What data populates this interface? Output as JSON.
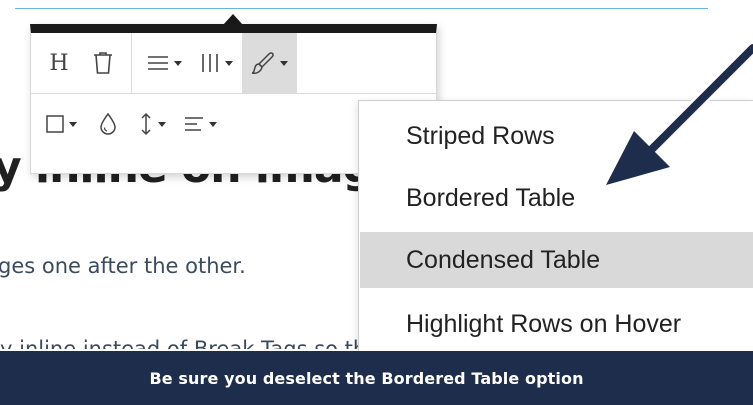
{
  "background": {
    "heading_fragment": "y inline on imag",
    "paragraph_fragment": "ges one after the other.",
    "partial_line_fragment": "y inline instead of Break Tags so the images are inline with"
  },
  "toolbar": {
    "row1": [
      {
        "name": "heading",
        "label": "H",
        "icon": "heading-icon"
      },
      {
        "name": "delete",
        "icon": "trash-icon"
      },
      {
        "name": "row-options",
        "icon": "rows-icon",
        "has_caret": true
      },
      {
        "name": "column-options",
        "icon": "columns-icon",
        "has_caret": true
      },
      {
        "name": "table-style",
        "icon": "brush-icon",
        "has_caret": true,
        "active": true
      }
    ],
    "row2": [
      {
        "name": "cell-border",
        "icon": "square-icon",
        "has_caret": true
      },
      {
        "name": "cell-color",
        "icon": "droplet-icon"
      },
      {
        "name": "vertical-align",
        "icon": "vertical-resize-icon",
        "has_caret": true
      },
      {
        "name": "horizontal-align",
        "icon": "align-left-icon",
        "has_caret": true
      }
    ]
  },
  "dropdown": {
    "items": [
      {
        "label": "Striped Rows",
        "highlighted": false
      },
      {
        "label": "Bordered Table",
        "highlighted": false
      },
      {
        "label": "Condensed Table",
        "highlighted": true
      },
      {
        "label": "Highlight Rows on Hover",
        "highlighted": false
      }
    ]
  },
  "caption": {
    "text": "Be sure you deselect the Bordered Table option"
  },
  "colors": {
    "caption_bar": "#1e2d4c",
    "arrow": "#1e2d4c",
    "top_rule": "#66b6e8",
    "active_button": "#dcdcdc",
    "highlighted_item": "#d9d9d9"
  }
}
